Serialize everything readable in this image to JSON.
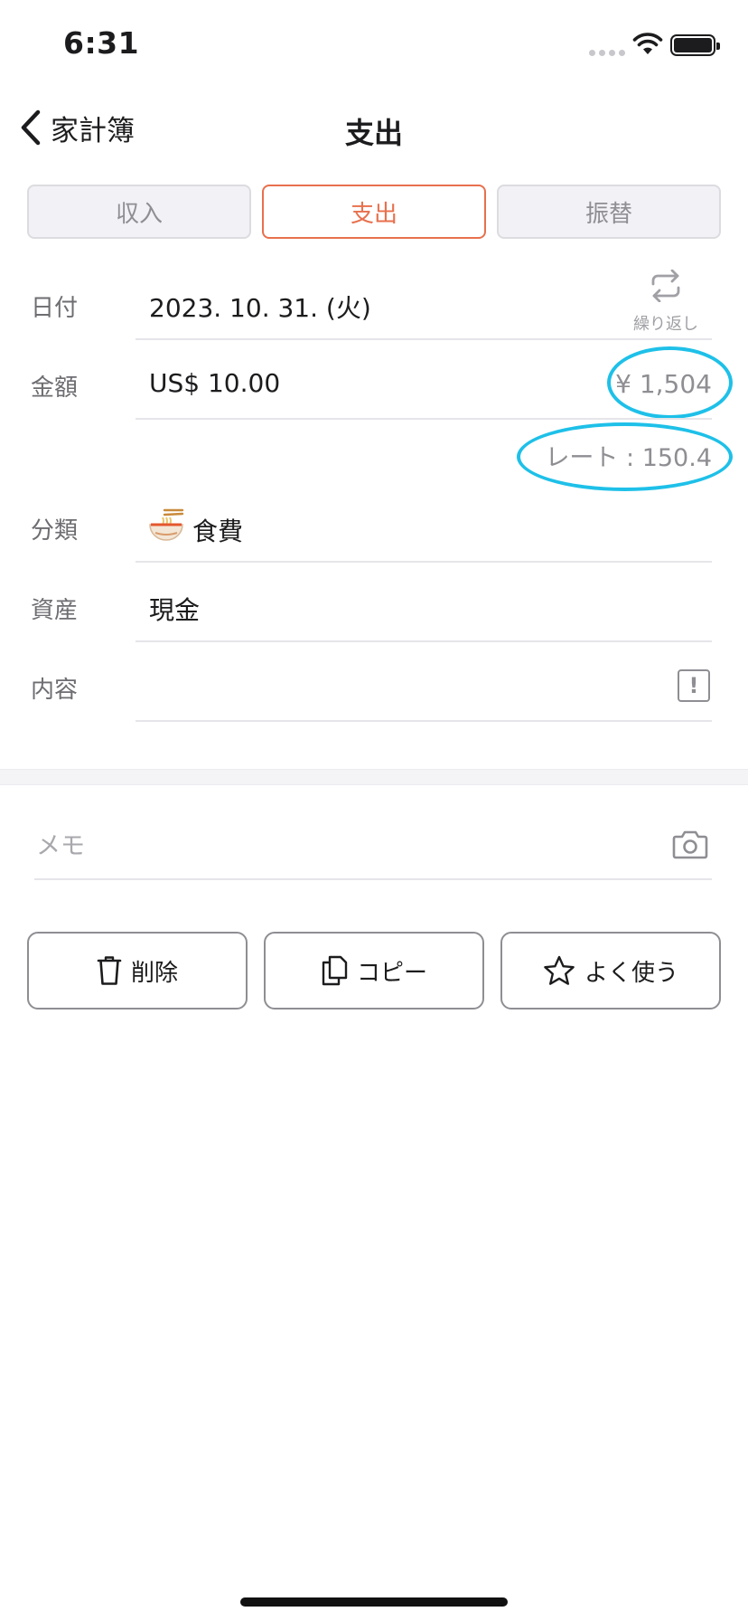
{
  "status_bar": {
    "time": "6:31"
  },
  "nav": {
    "back_label": "家計簿",
    "title": "支出"
  },
  "tabs": [
    {
      "label": "収入",
      "active": false
    },
    {
      "label": "支出",
      "active": true
    },
    {
      "label": "振替",
      "active": false
    }
  ],
  "form": {
    "date": {
      "label": "日付",
      "value": "2023. 10. 31. (火)",
      "repeat_label": "繰り返し"
    },
    "amount": {
      "label": "金額",
      "value": "US$ 10.00",
      "converted": "¥ 1,504",
      "rate": "レート : 150.4"
    },
    "category": {
      "label": "分類",
      "value": "食費",
      "icon": "ramen-bowl-icon"
    },
    "asset": {
      "label": "資産",
      "value": "現金"
    },
    "content": {
      "label": "内容",
      "value": ""
    }
  },
  "memo": {
    "placeholder": "メモ"
  },
  "actions": {
    "delete": "削除",
    "copy": "コピー",
    "favorite": "よく使う"
  },
  "colors": {
    "accent": "#e8704d",
    "highlight": "#1ec0e8"
  }
}
